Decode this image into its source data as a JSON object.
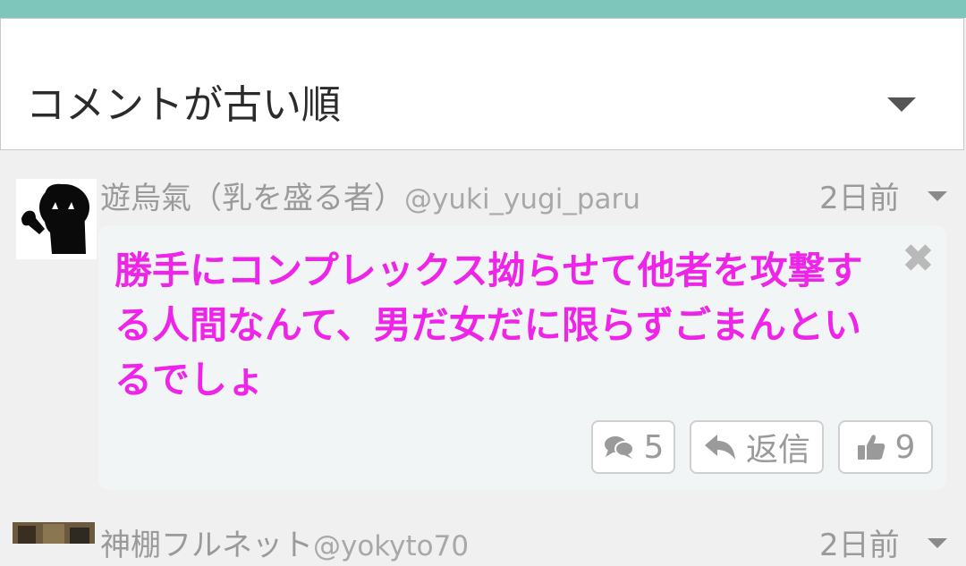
{
  "sort": {
    "selected_label": "コメントが古い順"
  },
  "comments": [
    {
      "author_name": "遊烏氣（乳を盛る者）",
      "author_handle": "@yuki_yugi_paru",
      "time": "2日前",
      "text": "勝手にコンプレックス拗らせて他者を攻撃する人間なんて、男だ女だに限らずごまんといるでしょ",
      "replies_count": "5",
      "reply_label": "返信",
      "likes_count": "9"
    },
    {
      "author_name": "神棚フルネット",
      "author_handle": "@yokyto70",
      "time": "2日前"
    }
  ],
  "colors": {
    "top_bar": "#7ec6bb",
    "comment_text": "#ee24e8",
    "muted_text": "#9a9a9a"
  },
  "icons": {
    "sort": "chevron-down-icon",
    "close": "close-icon",
    "replies": "comment-bubbles-icon",
    "reply": "reply-arrow-icon",
    "like": "thumbs-up-icon"
  }
}
